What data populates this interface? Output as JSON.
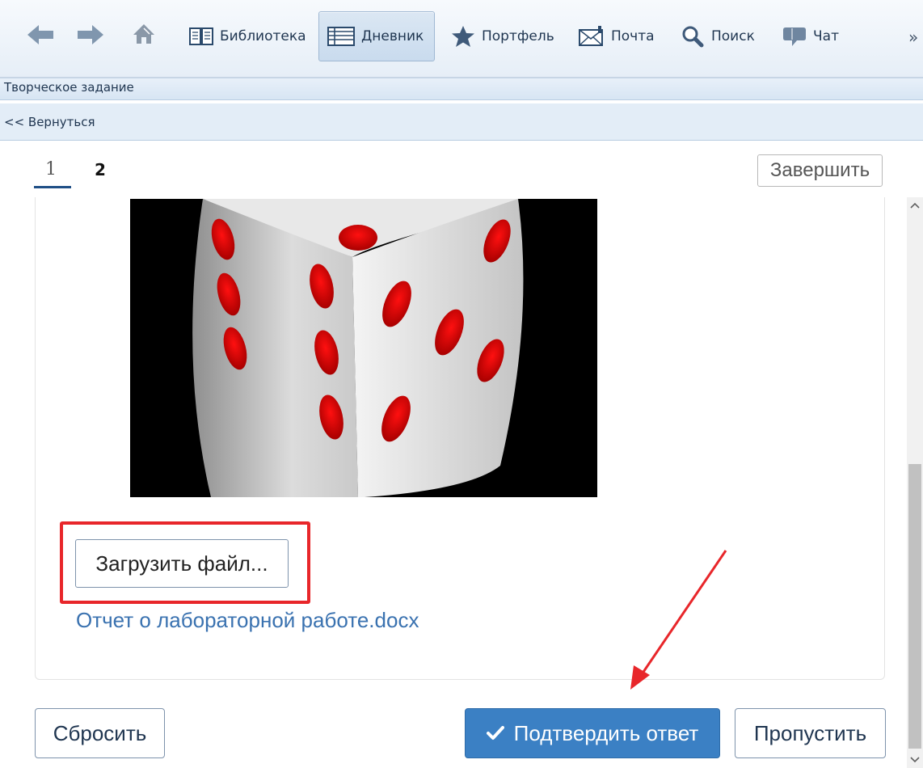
{
  "toolbar": {
    "items": [
      {
        "label": "Библиотека",
        "icon": "book-icon"
      },
      {
        "label": "Дневник",
        "icon": "diary-icon",
        "active": true
      },
      {
        "label": "Портфель",
        "icon": "star-icon"
      },
      {
        "label": "Почта",
        "icon": "mail-icon"
      },
      {
        "label": "Поиск",
        "icon": "search-icon"
      },
      {
        "label": "Чат",
        "icon": "chat-icon"
      }
    ],
    "more": "»"
  },
  "header": {
    "title": "Творческое задание",
    "back_link": "<< Вернуться"
  },
  "pager": {
    "pages": [
      "1",
      "2"
    ],
    "current": "1"
  },
  "finish_button": "Завершить",
  "task": {
    "upload_button": "Загрузить файл...",
    "uploaded_file": "Отчет о лабораторной работе.docx"
  },
  "actions": {
    "reset": "Сбросить",
    "confirm": "Подтвердить ответ",
    "skip": "Пропустить"
  },
  "colors": {
    "accent": "#3b80c4",
    "highlight": "#e8262a",
    "link": "#3a72b0"
  }
}
